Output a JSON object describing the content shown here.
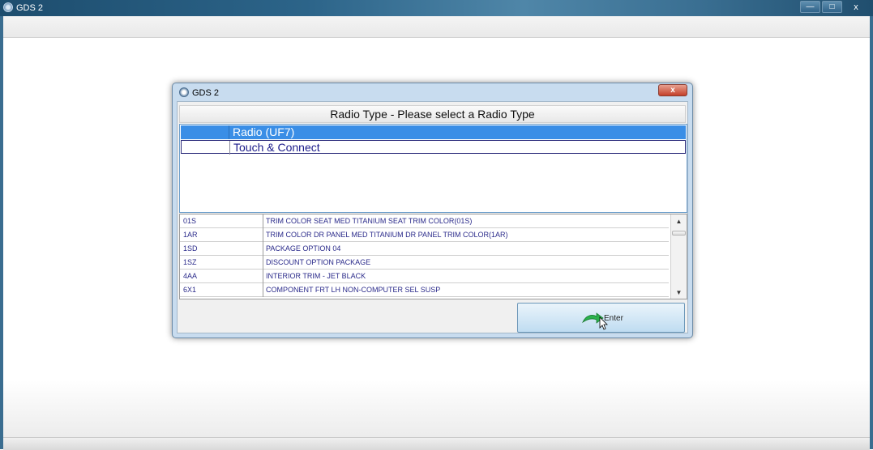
{
  "window": {
    "title": "GDS 2",
    "minimize": "—",
    "maximize": "□",
    "close": "x"
  },
  "dialog": {
    "title": "GDS 2",
    "close": "x",
    "heading": "Radio Type - Please select a Radio Type",
    "radio_options": [
      {
        "label": "Radio (UF7)",
        "selected": true
      },
      {
        "label": "Touch & Connect",
        "selected": false
      }
    ],
    "option_rows": [
      {
        "code": "01S",
        "desc": "TRIM COLOR SEAT MED TITANIUM SEAT TRIM COLOR(01S)"
      },
      {
        "code": "1AR",
        "desc": "TRIM COLOR DR PANEL MED TITANIUM DR PANEL TRIM COLOR(1AR)"
      },
      {
        "code": "1SD",
        "desc": "PACKAGE OPTION 04"
      },
      {
        "code": "1SZ",
        "desc": "DISCOUNT OPTION PACKAGE"
      },
      {
        "code": "4AA",
        "desc": "INTERIOR TRIM - JET BLACK"
      },
      {
        "code": "6X1",
        "desc": "COMPONENT FRT LH NON-COMPUTER SEL SUSP"
      }
    ],
    "scroll_up": "▲",
    "scroll_down": "▼",
    "enter_label": "Enter"
  },
  "colors": {
    "selection": "#3a8ee6",
    "text_blue": "#2a2a8a",
    "enter_arrow": "#2bb24c"
  }
}
